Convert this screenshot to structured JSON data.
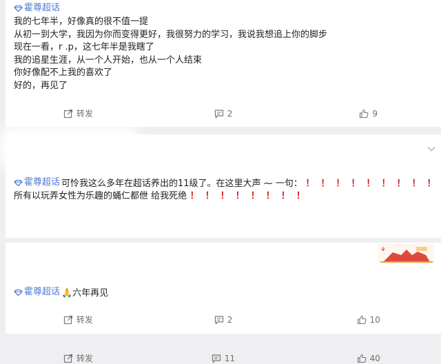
{
  "topic_label": "霍尊超话",
  "posts": [
    {
      "lines": [
        "我的七年半，好像真的很不值一提",
        "从初一到大学，我因为你而变得更好，我很努力的学习，我说我想追上你的脚步",
        "现在一看，r    .p，这七年半是我瞎了",
        "我的追星生涯，从一个人开始，也从一个人结束",
        "你好像配不上我的喜欢了",
        "好的，再见了"
      ],
      "actions": {
        "repost": "转发",
        "comments": "2",
        "likes": "9"
      }
    },
    {
      "line1_text": "可怜我这么多年在超话养出的11级了。在这里大声 ⁓ 一句：",
      "line2_text": "所有以玩弄女性为乐趣的蛹仁都伳    给我死绝",
      "excl_line1": [
        "！",
        "！",
        "！",
        "！",
        "！",
        "！",
        "！",
        "！",
        "！"
      ],
      "excl_line2": [
        "！",
        "！",
        "！",
        "！",
        "！",
        "！",
        "！",
        "！"
      ],
      "actions": {
        "repost": "转发",
        "comments": "11",
        "likes": "40"
      }
    },
    {
      "emoji": "🙏",
      "text": "六年再见",
      "actions": {
        "repost": "转发",
        "comments": "2",
        "likes": "10"
      }
    }
  ],
  "icons": {
    "topic": "diamond-topic-icon",
    "repost": "repost-icon",
    "comment": "comment-icon",
    "like": "thumbs-up-icon",
    "more": "chevron-down-icon"
  },
  "colors": {
    "topic_blue": "#4f7bd0",
    "exclaim_red": "#e0161d",
    "action_gray": "#6f6f6f",
    "page_bg": "#efeff2"
  }
}
